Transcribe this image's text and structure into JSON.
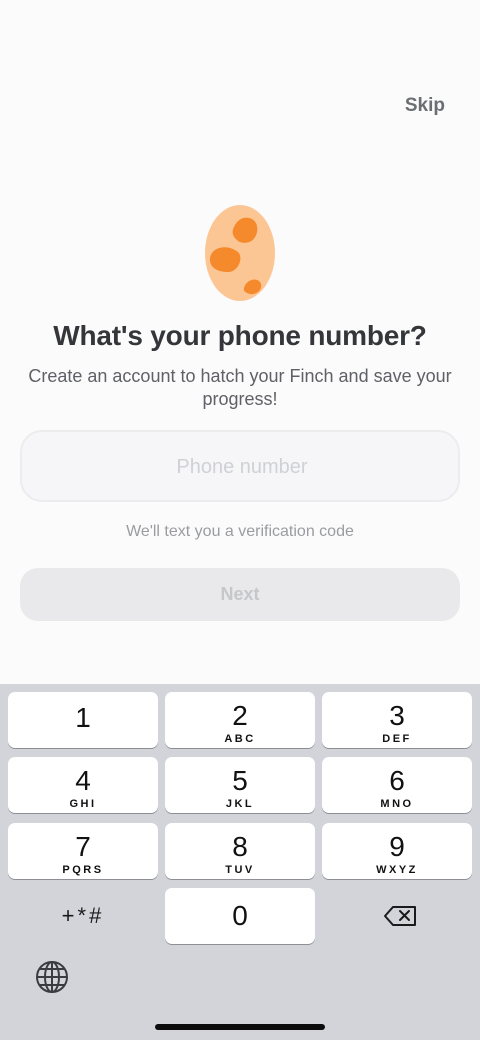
{
  "header": {
    "skip_label": "Skip"
  },
  "hero": {
    "egg_icon": "spotted-egg-icon",
    "title": "What's your phone number?",
    "subtitle": "Create an account to hatch your Finch and save your progress!"
  },
  "form": {
    "phone_value": "",
    "phone_placeholder": "Phone number",
    "hint": "We'll text you a verification code",
    "next_label": "Next"
  },
  "keyboard": {
    "keys": [
      {
        "digit": "1",
        "letters": ""
      },
      {
        "digit": "2",
        "letters": "ABC"
      },
      {
        "digit": "3",
        "letters": "DEF"
      },
      {
        "digit": "4",
        "letters": "GHI"
      },
      {
        "digit": "5",
        "letters": "JKL"
      },
      {
        "digit": "6",
        "letters": "MNO"
      },
      {
        "digit": "7",
        "letters": "PQRS"
      },
      {
        "digit": "8",
        "letters": "TUV"
      },
      {
        "digit": "9",
        "letters": "WXYZ"
      },
      {
        "digit": "0",
        "letters": ""
      }
    ],
    "symbols_label": "+*#",
    "delete_icon": "backspace-icon",
    "globe_icon": "globe-icon"
  },
  "colors": {
    "background": "#fcfbfc",
    "egg_body": "#fcc694",
    "egg_spots": "#f58a2d",
    "keyboard_bg": "#d2d4d9"
  }
}
